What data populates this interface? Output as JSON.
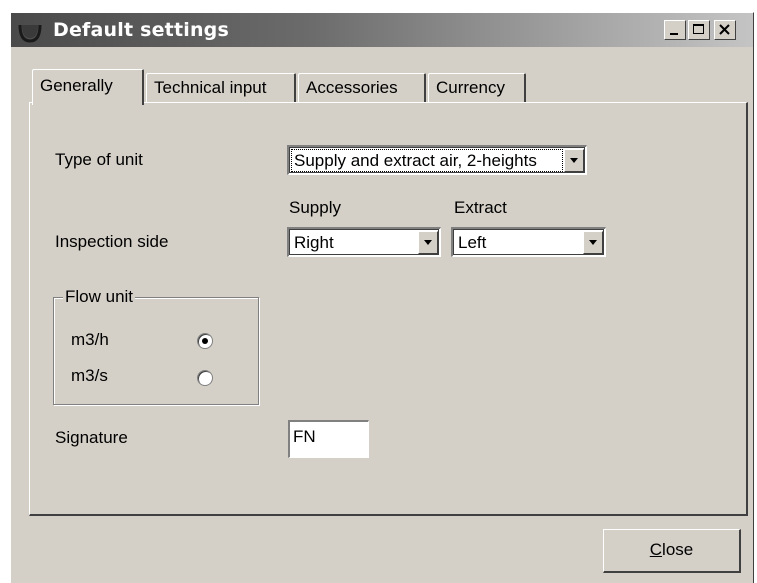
{
  "window": {
    "title": "Default settings",
    "controls": {
      "minimize_icon": "minimize-icon",
      "maximize_icon": "maximize-icon",
      "close_icon": "close-icon"
    }
  },
  "tabs": [
    {
      "label": "Generally",
      "active": true
    },
    {
      "label": "Technical input",
      "active": false
    },
    {
      "label": "Accessories",
      "active": false
    },
    {
      "label": "Currency",
      "active": false
    }
  ],
  "form": {
    "type_of_unit": {
      "label": "Type of unit",
      "value": "Supply and extract air, 2-heights"
    },
    "inspection_side": {
      "label": "Inspection side",
      "supply_header": "Supply",
      "extract_header": "Extract",
      "supply_value": "Right",
      "extract_value": "Left"
    },
    "flow_unit": {
      "legend": "Flow unit",
      "options": [
        {
          "label": "m3/h",
          "checked": true
        },
        {
          "label": "m3/s",
          "checked": false
        }
      ]
    },
    "signature": {
      "label": "Signature",
      "value": "FN"
    }
  },
  "footer": {
    "close_label_mnemonic": "C",
    "close_label_rest": "lose"
  },
  "colors": {
    "face": "#d4d0c8",
    "title_dark": "#4a4a4a",
    "title_light": "#c4c4c4"
  }
}
